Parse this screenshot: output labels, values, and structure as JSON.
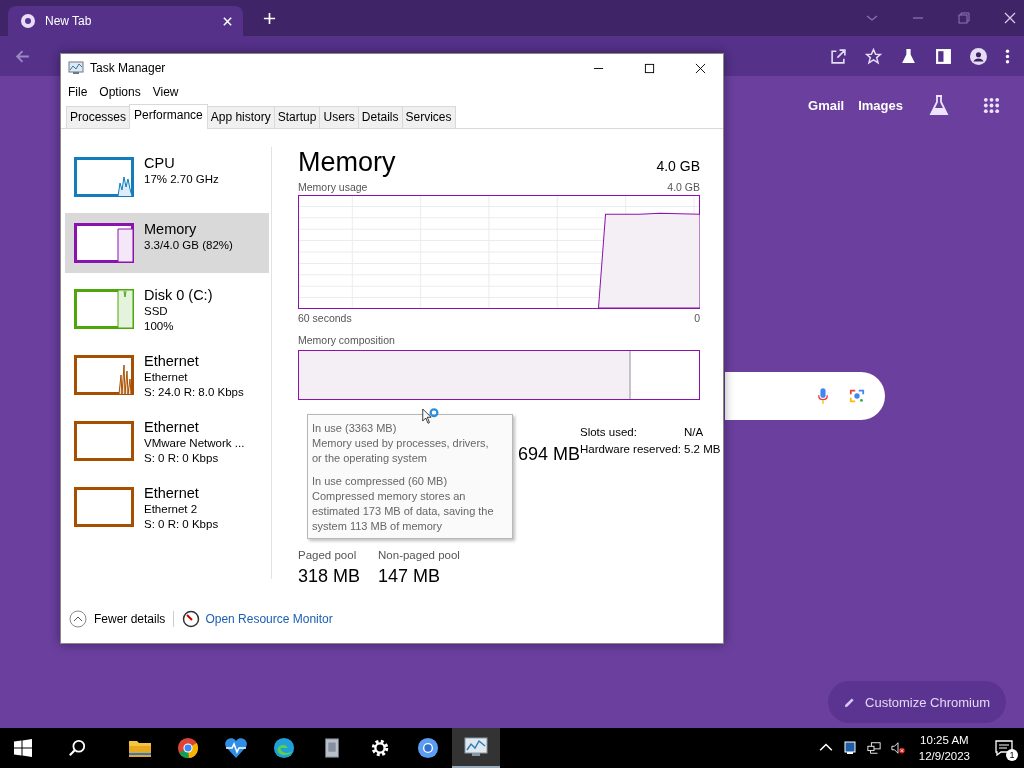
{
  "browser": {
    "tab": {
      "title": "New Tab"
    },
    "header_links": [
      {
        "label": "Gmail"
      },
      {
        "label": "Images"
      }
    ],
    "customize_button": {
      "label": "Customize Chromium"
    }
  },
  "task_manager": {
    "title": "Task Manager",
    "menu": [
      "File",
      "Options",
      "View"
    ],
    "tabs": [
      {
        "label": "Processes",
        "selected": false
      },
      {
        "label": "Performance",
        "selected": true
      },
      {
        "label": "App history",
        "selected": false
      },
      {
        "label": "Startup",
        "selected": false
      },
      {
        "label": "Users",
        "selected": false
      },
      {
        "label": "Details",
        "selected": false
      },
      {
        "label": "Services",
        "selected": false
      }
    ],
    "sidebar": [
      {
        "kind": "cpu",
        "name": "CPU",
        "lines": [
          "17% 2.70 GHz"
        ],
        "color": "#117dbb",
        "selected": false
      },
      {
        "kind": "memory",
        "name": "Memory",
        "lines": [
          "3.3/4.0 GB (82%)"
        ],
        "color": "#8b12ae",
        "selected": true
      },
      {
        "kind": "disk",
        "name": "Disk 0 (C:)",
        "lines": [
          "SSD",
          "100%"
        ],
        "color": "#4da60c",
        "selected": false
      },
      {
        "kind": "network_busy",
        "name": "Ethernet",
        "lines": [
          "Ethernet",
          "S: 24.0 R: 8.0 Kbps"
        ],
        "color": "#a74f01",
        "selected": false
      },
      {
        "kind": "network_idle",
        "name": "Ethernet",
        "lines": [
          "VMware Network ...",
          "S: 0 R: 0 Kbps"
        ],
        "color": "#a74f01",
        "selected": false
      },
      {
        "kind": "network_idle",
        "name": "Ethernet",
        "lines": [
          "Ethernet 2",
          "S: 0 R: 0 Kbps"
        ],
        "color": "#a74f01",
        "selected": false
      }
    ],
    "detail": {
      "title": "Memory",
      "total": "4.0 GB",
      "usage_label": "Memory usage",
      "usage_max": "4.0 GB",
      "axis_start": "60 seconds",
      "axis_end": "0",
      "composition_label": "Memory composition",
      "composition": {
        "level": 0.83
      },
      "available_value": "694 MB",
      "pools": [
        {
          "label": "Paged pool",
          "value": "318 MB"
        },
        {
          "label": "Non-paged pool",
          "value": "147 MB"
        }
      ],
      "hardware": [
        {
          "label": "Slots used:",
          "value": "N/A"
        },
        {
          "label": "Hardware reserved:",
          "value": "5.2 MB"
        }
      ],
      "tooltip": [
        {
          "title": "In use (3363 MB)",
          "text": "Memory used by processes, drivers, or the operating system"
        },
        {
          "title": "In use compressed (60 MB)",
          "text": "Compressed memory stores an estimated 173 MB of data, saving the system 113 MB of memory"
        }
      ]
    },
    "footer": {
      "fewer_details": "Fewer details",
      "resource_monitor": "Open Resource Monitor"
    }
  },
  "taskbar": {
    "apps": [
      {
        "kind": "folder",
        "active": false
      },
      {
        "kind": "chrome",
        "active": false
      },
      {
        "kind": "heart",
        "active": false
      },
      {
        "kind": "edge",
        "active": false
      },
      {
        "kind": "installer",
        "active": false
      },
      {
        "kind": "gear",
        "active": false
      },
      {
        "kind": "chromium",
        "active": false
      },
      {
        "kind": "monitor",
        "active": true
      }
    ],
    "time": "10:25 AM",
    "date": "12/9/2023",
    "notifications": "1"
  }
}
